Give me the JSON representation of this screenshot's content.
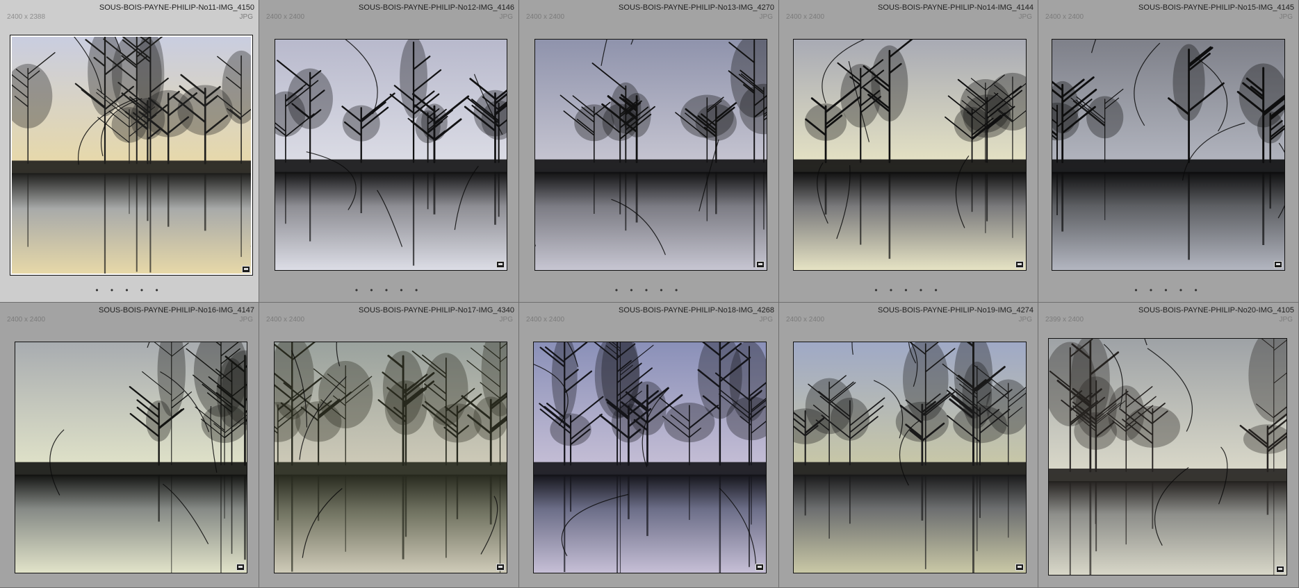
{
  "grid": {
    "cells": [
      {
        "filename": "SOUS-BOIS-PAYNE-PHILIP-No11-IMG_4150",
        "dims": "2400 x 2388",
        "type": "JPG",
        "rating": "• • • • •",
        "sky": "#e8d9a8",
        "skyTop": "#c9cde0",
        "fog": "#a8aaa9",
        "ground": "#1e1e1c"
      },
      {
        "filename": "SOUS-BOIS-PAYNE-PHILIP-No12-IMG_4146",
        "dims": "2400 x 2400",
        "type": "JPG",
        "rating": "• • • • •",
        "sky": "#dcdde6",
        "skyTop": "#b8b9cc",
        "fog": "#8e8e94",
        "ground": "#121213"
      },
      {
        "filename": "SOUS-BOIS-PAYNE-PHILIP-No13-IMG_4270",
        "dims": "2400 x 2400",
        "type": "JPG",
        "rating": "• • • • •",
        "sky": "#c7c6d2",
        "skyTop": "#8f93ac",
        "fog": "#7c7c84",
        "ground": "#111112"
      },
      {
        "filename": "SOUS-BOIS-PAYNE-PHILIP-No14-IMG_4144",
        "dims": "2400 x 2400",
        "type": "JPG",
        "rating": "• • • • •",
        "sky": "#e6e3c4",
        "skyTop": "#a8aab4",
        "fog": "#7a7a7c",
        "ground": "#101010"
      },
      {
        "filename": "SOUS-BOIS-PAYNE-PHILIP-No15-IMG_4145",
        "dims": "2400 x 2400",
        "type": "JPG",
        "rating": "• • • • •",
        "sky": "#b3b6c0",
        "skyTop": "#7e8089",
        "fog": "#5e6064",
        "ground": "#0e0e0f"
      },
      {
        "filename": "SOUS-BOIS-PAYNE-PHILIP-No16-IMG_4147",
        "dims": "2400 x 2400",
        "type": "JPG",
        "rating": "",
        "sky": "#e1e3c9",
        "skyTop": "#a8acb0",
        "fog": "#868a86",
        "ground": "#131412"
      },
      {
        "filename": "SOUS-BOIS-PAYNE-PHILIP-No17-IMG_4340",
        "dims": "2400 x 2400",
        "type": "JPG",
        "rating": "",
        "sky": "#cfcbb8",
        "skyTop": "#9aa29e",
        "fog": "#6c6e5d",
        "ground": "#27291e"
      },
      {
        "filename": "SOUS-BOIS-PAYNE-PHILIP-No18-IMG_4268",
        "dims": "2400 x 2400",
        "type": "JPG",
        "rating": "",
        "sky": "#c6bfd6",
        "skyTop": "#8a90b8",
        "fog": "#6c6e88",
        "ground": "#14141a"
      },
      {
        "filename": "SOUS-BOIS-PAYNE-PHILIP-No19-IMG_4274",
        "dims": "2400 x 2400",
        "type": "JPG",
        "rating": "",
        "sky": "#c9c8a6",
        "skyTop": "#9fa9c6",
        "fog": "#6d6f70",
        "ground": "#19191a"
      },
      {
        "filename": "SOUS-BOIS-PAYNE-PHILIP-No20-IMG_4105",
        "dims": "2399 x 2400",
        "type": "JPG",
        "rating": "",
        "sky": "#d8d7c8",
        "skyTop": "#9ea2a6",
        "fog": "#8d8e8a",
        "ground": "#252220"
      }
    ]
  }
}
